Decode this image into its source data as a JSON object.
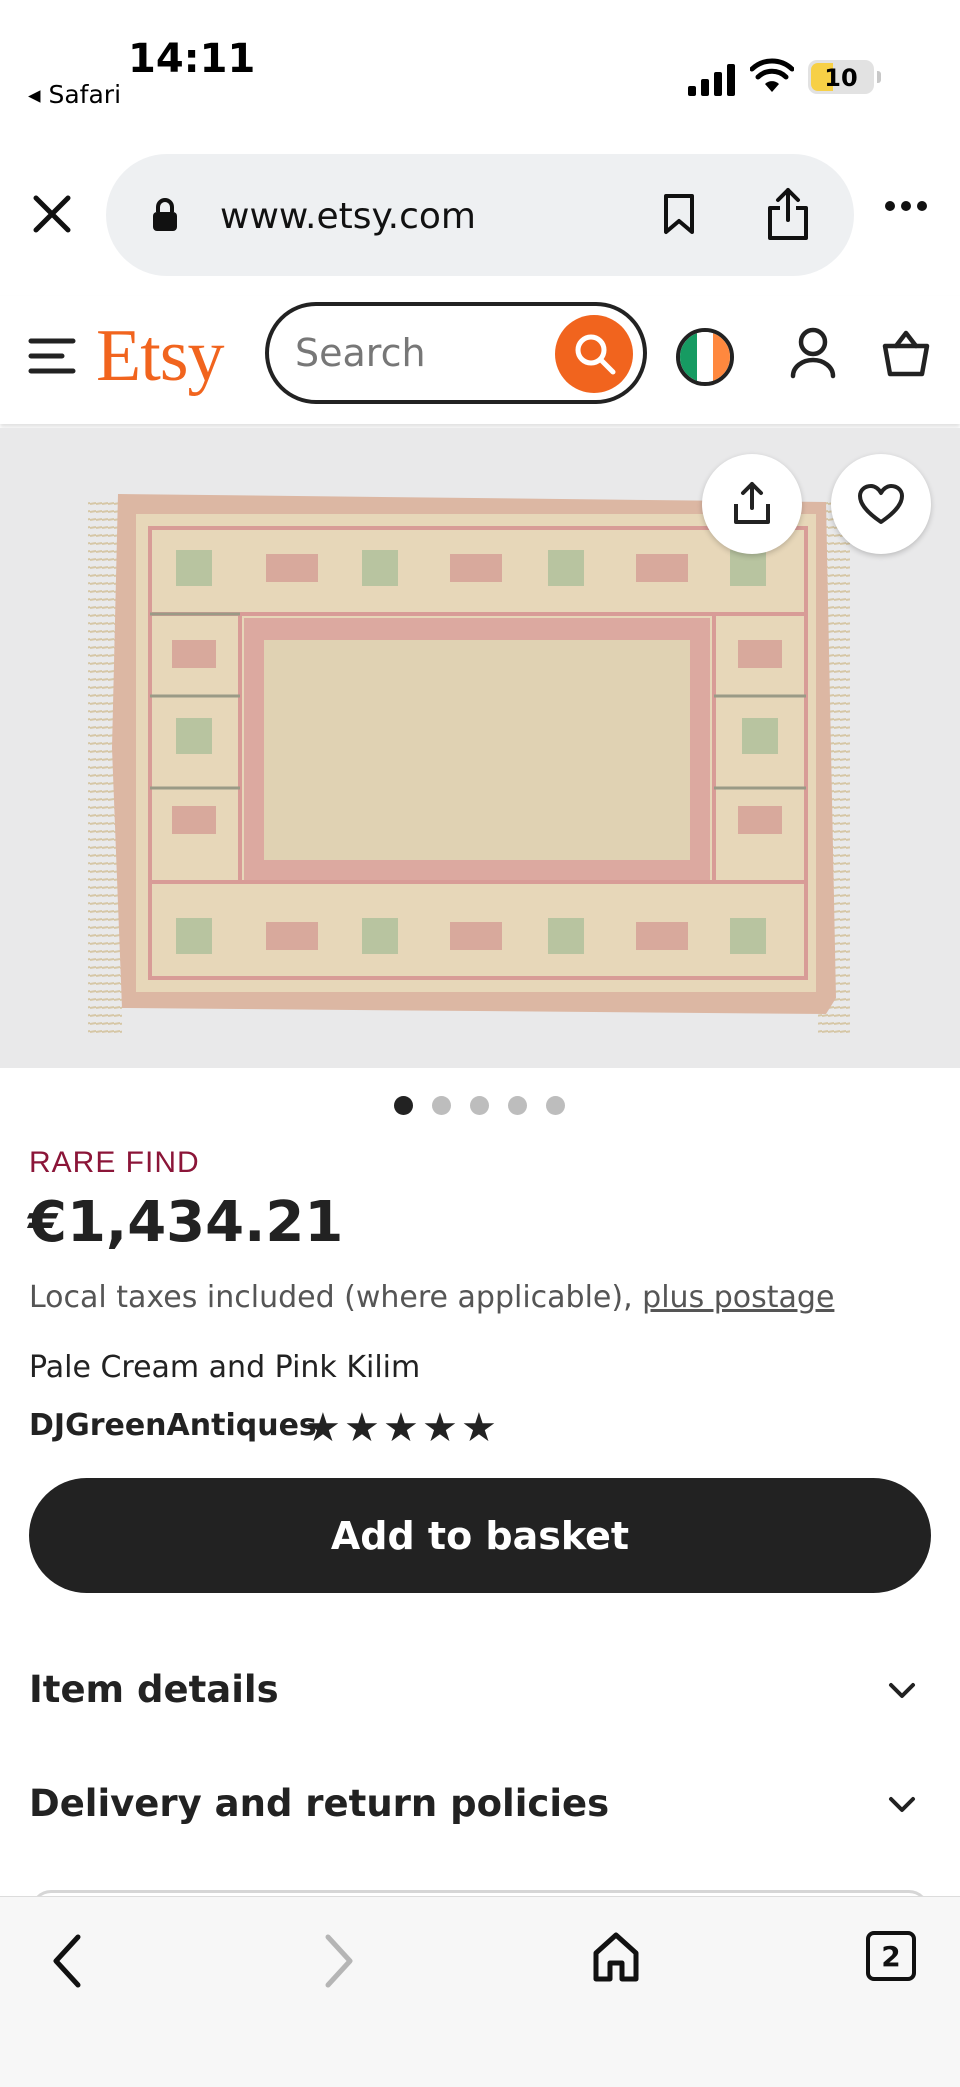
{
  "status_bar": {
    "time": "14:11",
    "back_app": "◂ Safari",
    "battery": "10",
    "battery_color": "#f7d046"
  },
  "browser": {
    "url": "www.etsy.com",
    "icons": [
      "close-icon",
      "lock-icon",
      "bookmark-icon",
      "share-icon",
      "more-icon"
    ]
  },
  "header": {
    "logo": "Etsy",
    "search_placeholder": "Search",
    "brand_color": "#f1641e",
    "icons": [
      "menu-icon",
      "search-icon",
      "ireland-flag-icon",
      "user-icon",
      "basket-icon"
    ]
  },
  "gallery": {
    "image": "Pale cream and pink kilim rug",
    "image_count": 5,
    "active_index": 0
  },
  "product": {
    "badge": "RARE FIND",
    "badge_color": "#8b1538",
    "price": "€1,434.21",
    "tax_note": "Local taxes included (where applicable), ",
    "postage_link": "plus postage",
    "title": "Pale Cream and Pink Kilim",
    "seller": "DJGreenAntiques",
    "rating": 5,
    "add_to_basket": "Add to basket"
  },
  "sections": [
    {
      "label": "Item details"
    },
    {
      "label": "Delivery and return policies"
    }
  ],
  "toolbar": {
    "tabs_count": "2",
    "icons": [
      "back-icon",
      "forward-icon",
      "home-icon",
      "tabs-icon"
    ]
  }
}
